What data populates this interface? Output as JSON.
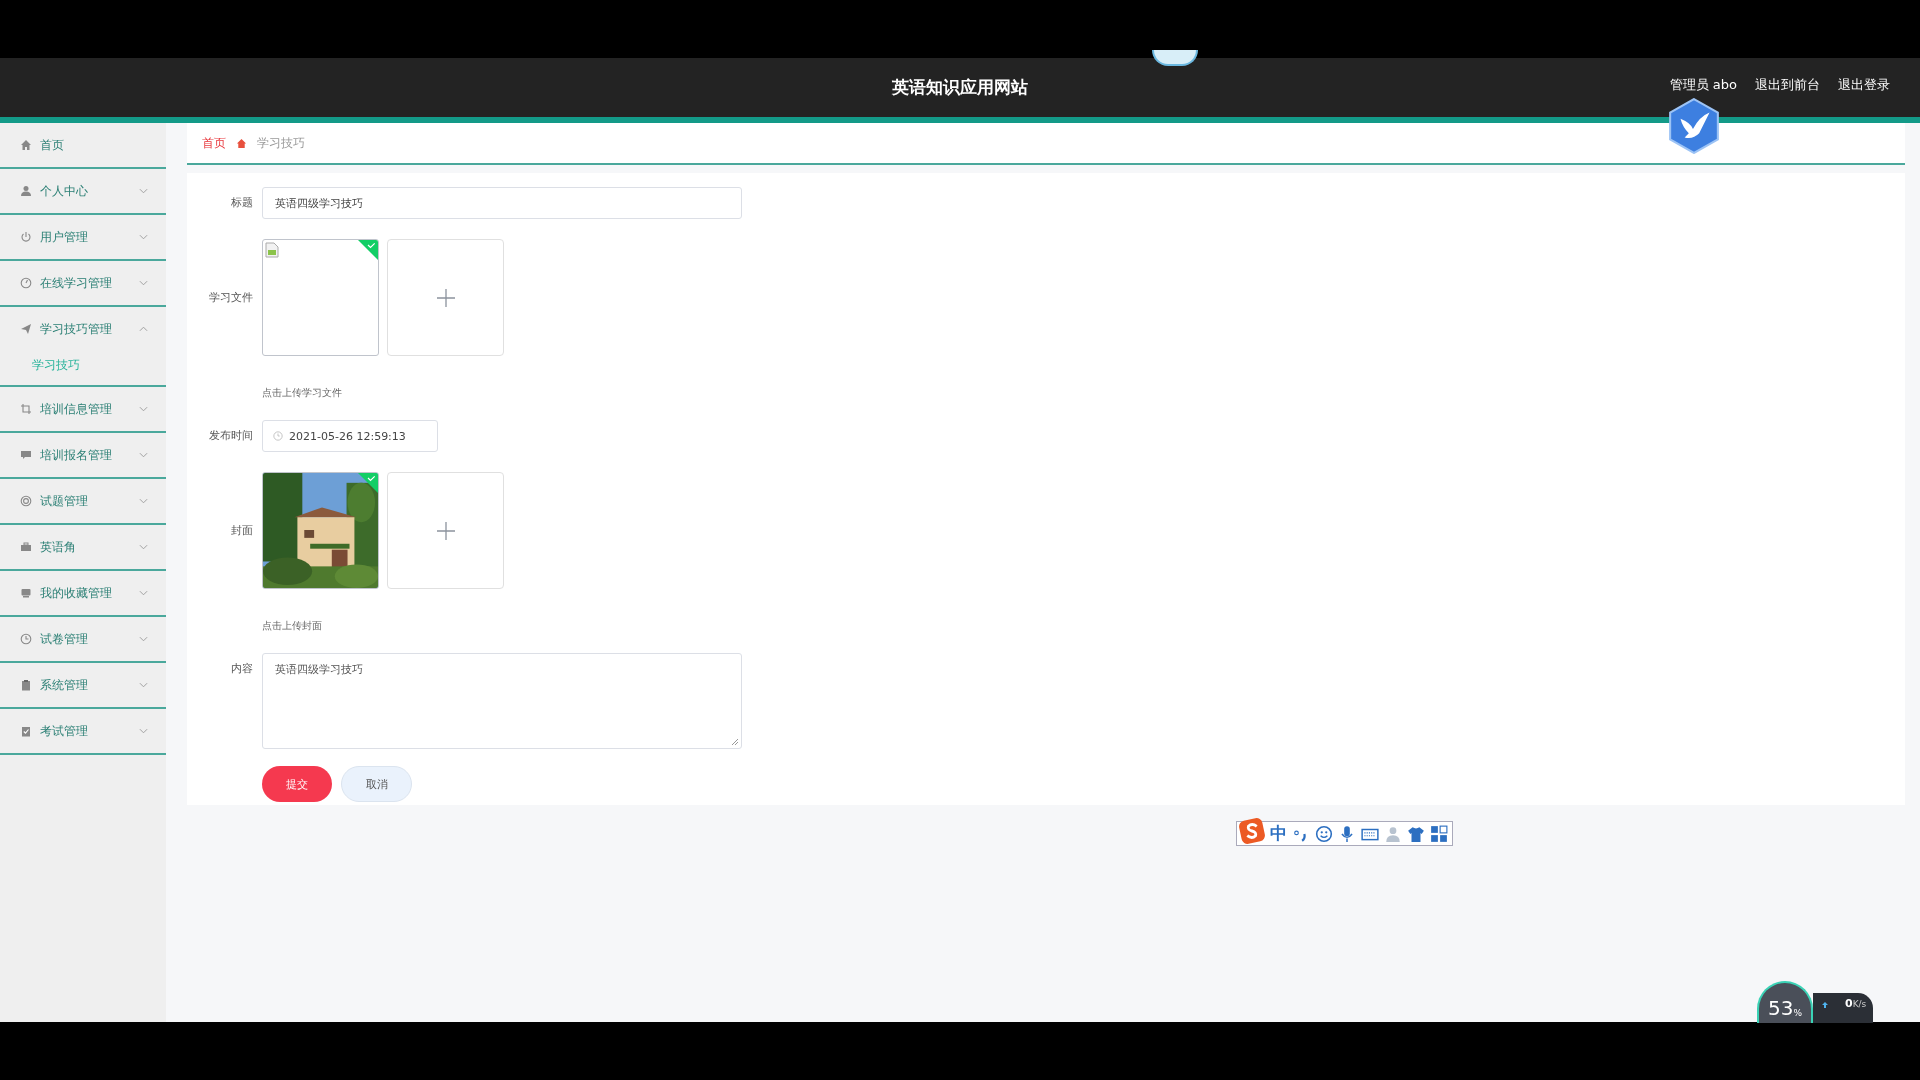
{
  "header": {
    "title": "英语知识应用网站",
    "links": [
      "管理员 abo",
      "退出到前台",
      "退出登录"
    ]
  },
  "sidebar": {
    "items": [
      {
        "label": "首页",
        "kind": "link"
      },
      {
        "label": "个人中心",
        "kind": "menu",
        "expanded": false
      },
      {
        "label": "用户管理",
        "kind": "menu",
        "expanded": false
      },
      {
        "label": "在线学习管理",
        "kind": "menu",
        "expanded": false
      },
      {
        "label": "学习技巧管理",
        "kind": "menu",
        "expanded": true,
        "children": [
          {
            "label": "学习技巧",
            "selected": true
          }
        ]
      },
      {
        "label": "培训信息管理",
        "kind": "menu",
        "expanded": false
      },
      {
        "label": "培训报名管理",
        "kind": "menu",
        "expanded": false
      },
      {
        "label": "试题管理",
        "kind": "menu",
        "expanded": false
      },
      {
        "label": "英语角",
        "kind": "menu",
        "expanded": false
      },
      {
        "label": "我的收藏管理",
        "kind": "menu",
        "expanded": false
      },
      {
        "label": "试卷管理",
        "kind": "menu",
        "expanded": false
      },
      {
        "label": "系统管理",
        "kind": "menu",
        "expanded": false
      },
      {
        "label": "考试管理",
        "kind": "menu",
        "expanded": false
      }
    ]
  },
  "breadcrumb": [
    "首页",
    "学习技巧"
  ],
  "form": {
    "fields": [
      {
        "kind": "text",
        "label": "标题",
        "value": "英语四级学习技巧"
      },
      {
        "kind": "upload",
        "label": "学习文件",
        "files": [
          {
            "kind": "broken-image",
            "success": true
          }
        ],
        "hint": "点击上传学习文件"
      },
      {
        "kind": "date",
        "label": "发布时间",
        "value": "2021-05-26 12:59:13"
      },
      {
        "kind": "upload",
        "label": "封面",
        "files": [
          {
            "kind": "picture",
            "success": true
          }
        ],
        "hint": "点击上传封面"
      },
      {
        "kind": "textarea",
        "label": "内容",
        "value": "英语四级学习技巧"
      }
    ],
    "buttons": [
      {
        "label": "提交",
        "kind": "primary"
      },
      {
        "label": "取消",
        "kind": "secondary"
      }
    ]
  },
  "ime_toolbar": {
    "mode": "中"
  },
  "speed_widget": {
    "percent": "53",
    "percent_unit": "%",
    "speed": "0",
    "speed_unit": "K/s"
  }
}
